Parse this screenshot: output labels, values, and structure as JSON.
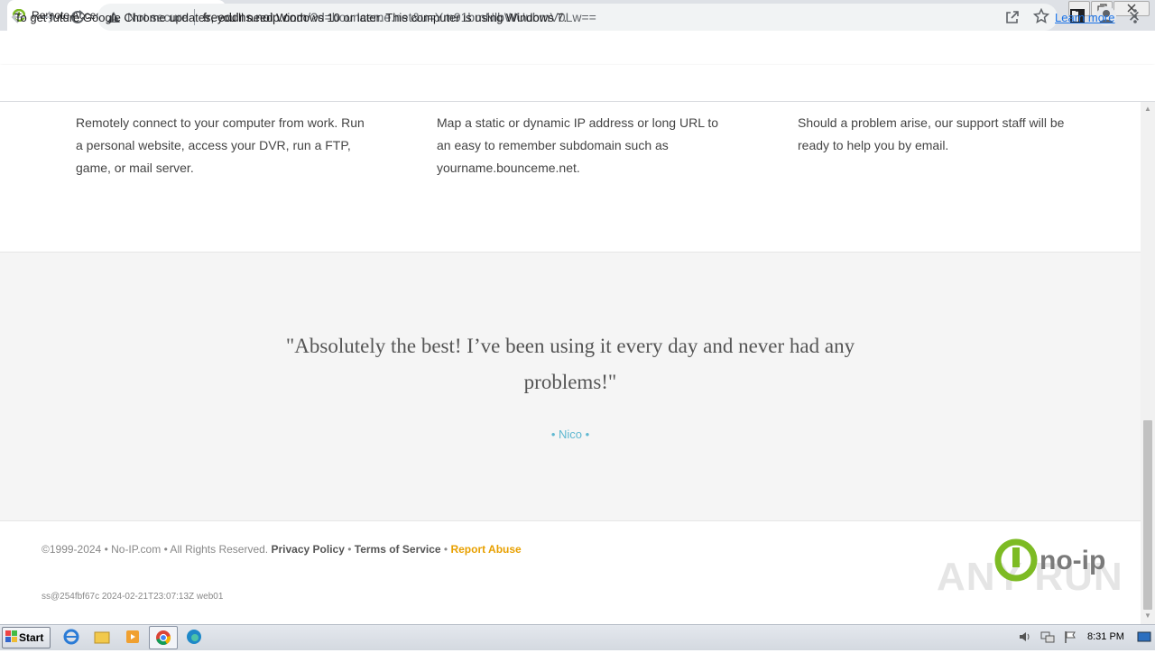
{
  "browser": {
    "tab_title": "Remote Access - Dynamic DNS - Cre",
    "tab_close": "✕",
    "new_tab": "+",
    "not_secure": "Not secure",
    "url_host": "freeddns.noip.com",
    "url_rest": "/?d=bounceme.net&u=Ym91bmNlbWUubmV0Lw==",
    "infobar_text": "To get future Google Chrome updates, you'll need Windows 10 or later. This computer is using Windows 7.",
    "infobar_link": "Learn more",
    "infobar_close": "✕"
  },
  "features": [
    "Remotely connect to your computer from work. Run a personal website, access your DVR, run a FTP, game, or mail server.",
    "Map a static or dynamic IP address or long URL to an easy to remember subdomain such as yourname.bounceme.net.",
    "Should a problem arise, our support staff will be ready to help you by email."
  ],
  "testimonial": {
    "quote": "\"Absolutely the best! I’ve been using it every day and never had any problems!\"",
    "author": "• Nico •"
  },
  "footer": {
    "copyright": "©1999-2024 • No-IP.com • All Rights Reserved.",
    "privacy": "Privacy Policy",
    "sep": " • ",
    "terms": "Terms of Service",
    "abuse": "Report Abuse",
    "build": "ss@254fbf67c 2024-02-21T23:07:13Z web01",
    "logo_text": "no-ip",
    "watermark": "ANY RUN"
  },
  "taskbar": {
    "start_label": "Start",
    "clock": "8:31 PM"
  },
  "colors": {
    "accent_link": "#1a73e8",
    "noip_green": "#7dbb24",
    "author_blue": "#5fb8d1",
    "abuse_orange": "#e8a000"
  }
}
